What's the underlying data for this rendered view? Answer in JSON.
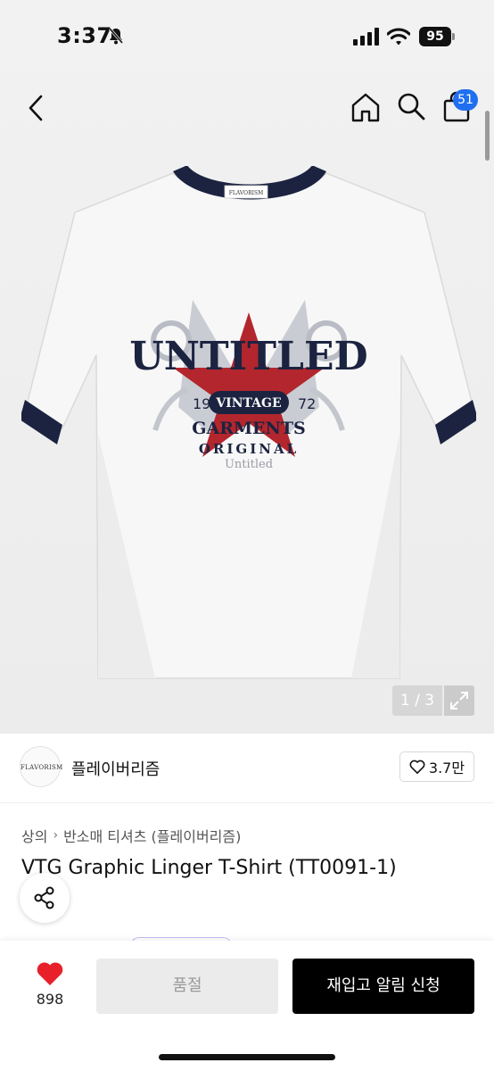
{
  "status_bar": {
    "time": "3:37",
    "battery": "95"
  },
  "nav": {
    "cart_count": "51"
  },
  "gallery": {
    "pager": "1 / 3",
    "shirt_print": {
      "brand_tag": "FLAVORISM",
      "line1": "UNTITLED",
      "year_left": "19",
      "badge": "VINTAGE",
      "year_right": "72",
      "line2": "GARMENTS",
      "line3": "ORIGINAL",
      "line4": "Untitled"
    }
  },
  "brand": {
    "logo_text": "FLAVORISM",
    "name": "플레이버리즘",
    "likes": "3.7만"
  },
  "breadcrumb": {
    "category": "상의",
    "subcategory": "반소매 티셔츠 (플레이버리즘)"
  },
  "product": {
    "title": "VTG Graphic Linger T-Shirt (TT0091-1)"
  },
  "bottom_bar": {
    "wish_count": "898",
    "soldout_label": "품절",
    "restock_label": "재입고 알림 신청"
  },
  "colors": {
    "accent_blue": "#1f6ff0",
    "heart_red": "#e8202a",
    "shirt_navy": "#1b2340",
    "star_red": "#b3262d"
  }
}
